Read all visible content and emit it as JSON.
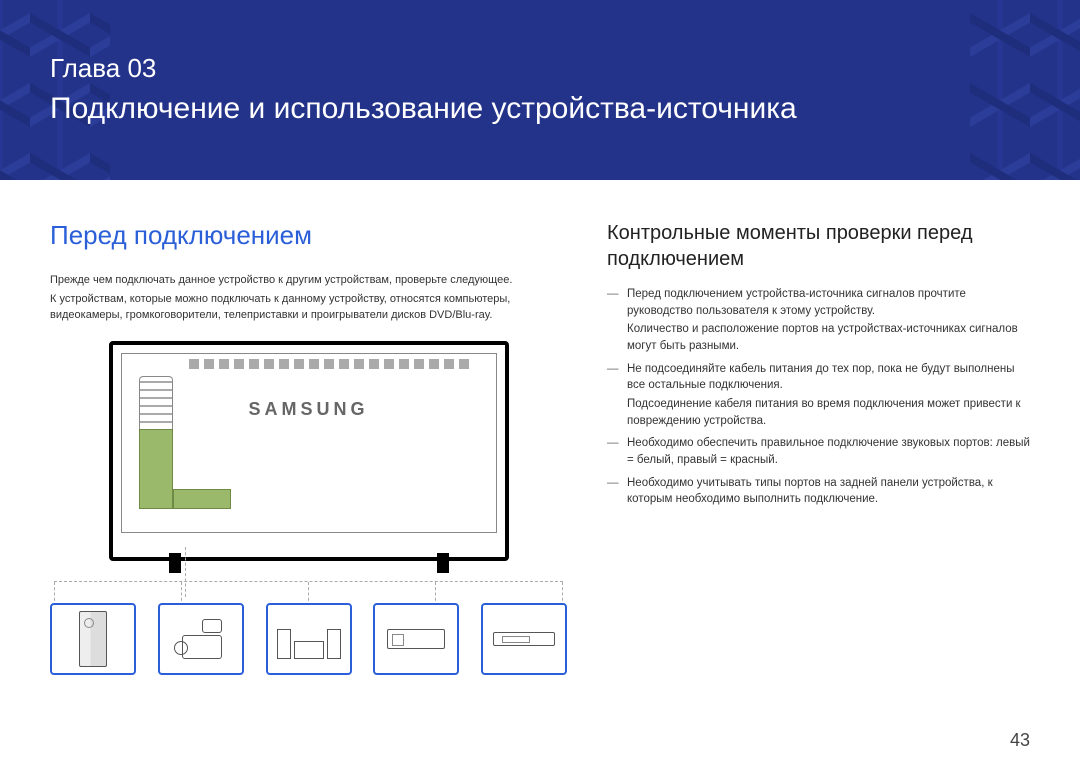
{
  "banner": {
    "chapter": "Глава 03",
    "title": "Подключение и использование устройства-источника"
  },
  "section": {
    "heading": "Перед подключением",
    "intro_1": "Прежде чем подключать данное устройство к другим устройствам, проверьте следующее.",
    "intro_2": "К устройствам, которые можно подключать к данному устройству, относятся компьютеры, видеокамеры, громкоговорители, телеприставки и проигрыватели дисков DVD/Blu-ray."
  },
  "diagram": {
    "logo": "SAMSUNG"
  },
  "checklist": {
    "heading": "Контрольные моменты проверки перед подключением",
    "items": [
      {
        "main": "Перед подключением устройства-источника сигналов прочтите руководство пользователя к этому устройству.",
        "sub": "Количество и расположение портов на устройствах-источниках сигналов могут быть разными."
      },
      {
        "main": "Не подсоединяйте кабель питания до тех пор, пока не будут выполнены все остальные подключения.",
        "sub": "Подсоединение кабеля питания во время подключения может привести к повреждению устройства."
      },
      {
        "main": "Необходимо обеспечить правильное подключение звуковых портов: левый = белый, правый = красный.",
        "sub": ""
      },
      {
        "main": "Необходимо учитывать типы портов на задней панели устройства, к которым необходимо выполнить подключение.",
        "sub": ""
      }
    ],
    "dash": "―"
  },
  "page": "43"
}
